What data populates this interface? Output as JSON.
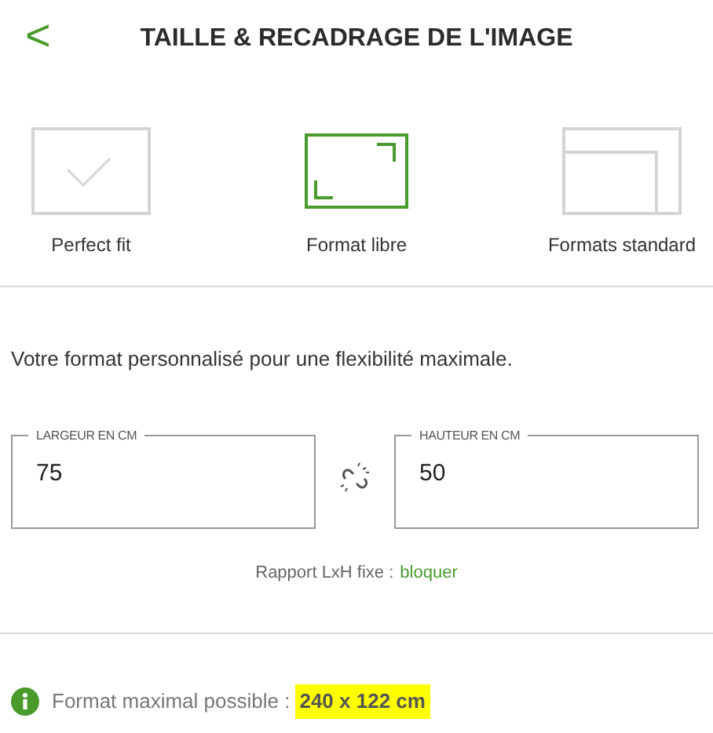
{
  "header": {
    "back": "<",
    "title": "TAILLE & RECADRAGE DE L'IMAGE"
  },
  "options": [
    {
      "kind": "check",
      "label": "Perfect fit",
      "selected": false
    },
    {
      "kind": "free",
      "label": "Format libre",
      "selected": true
    },
    {
      "kind": "standard",
      "label": "Formats standard",
      "selected": false
    }
  ],
  "description": "Votre format personnalisé pour une flexibilité maximale.",
  "fields": [
    {
      "label": "LARGEUR EN CM",
      "value": "75"
    },
    {
      "label": "HAUTEUR EN CM",
      "value": "50"
    }
  ],
  "ratio": {
    "label": "Rapport LxH fixe :",
    "link": "bloquer"
  },
  "info": {
    "label": "Format maximal possible :",
    "value": "240 x 122 cm"
  }
}
